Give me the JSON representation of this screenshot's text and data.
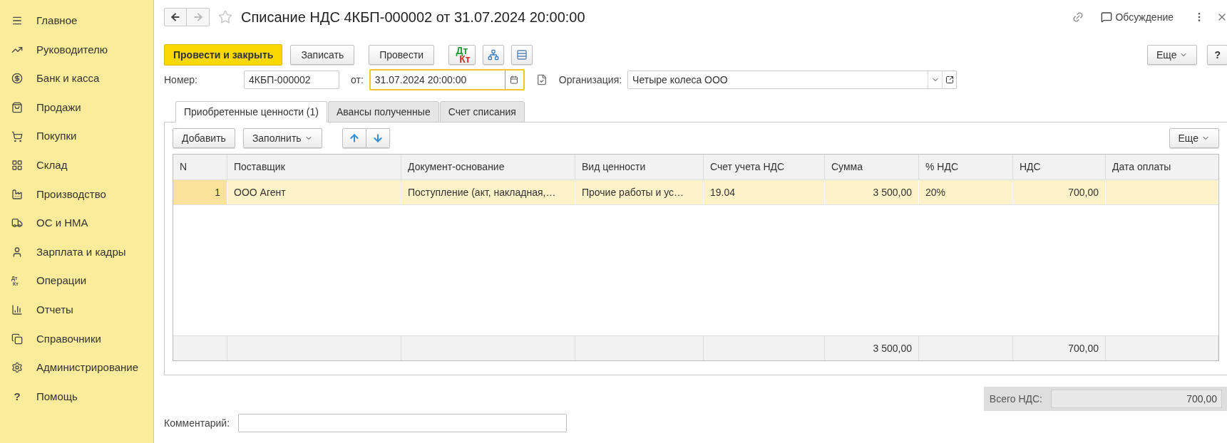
{
  "sidebar": {
    "items": [
      {
        "label": "Главное"
      },
      {
        "label": "Руководителю"
      },
      {
        "label": "Банк и касса"
      },
      {
        "label": "Продажи"
      },
      {
        "label": "Покупки"
      },
      {
        "label": "Склад"
      },
      {
        "label": "Производство"
      },
      {
        "label": "ОС и НМА"
      },
      {
        "label": "Зарплата и кадры"
      },
      {
        "label": "Операции",
        "icon_dt": "Дт",
        "icon_kt": "Кт"
      },
      {
        "label": "Отчеты"
      },
      {
        "label": "Справочники"
      },
      {
        "label": "Администрирование"
      },
      {
        "label": "Помощь",
        "icon_text": "?"
      }
    ]
  },
  "window": {
    "title": "Списание НДС 4КБП-000002 от 31.07.2024 20:00:00",
    "discussion": "Обсуждение"
  },
  "toolbar": {
    "primary": "Провести и закрыть",
    "buttons": [
      "Записать",
      "Провести"
    ],
    "dt_kt": {
      "dt": "Дт",
      "kt": "Кт"
    },
    "more": "Еще",
    "help": "?"
  },
  "header": {
    "number_label": "Номер:",
    "number": "4КБП-000002",
    "date_label": "от:",
    "date": "31.07.2024 20:00:00",
    "date_focused": true,
    "org_label": "Организация:",
    "org": "Четыре колеса ООО"
  },
  "tabs": [
    {
      "label": "Приобретенные ценности (1)",
      "selected": true
    },
    {
      "label": "Авансы полученные",
      "selected": false
    },
    {
      "label": "Счет списания",
      "selected": false
    }
  ],
  "table_toolbar": {
    "add": "Добавить",
    "fill": "Заполнить",
    "more": "Еще"
  },
  "table": {
    "columns": [
      "N",
      "Поставщик",
      "Документ-основание",
      "Вид ценности",
      "Счет учета НДС",
      "Сумма",
      "% НДС",
      "НДС",
      "Дата оплаты"
    ],
    "rows": [
      {
        "selected": true,
        "cells": [
          "1",
          "ООО Агент",
          "Поступление (акт, накладная,…",
          "Прочие работы и ус…",
          "19.04",
          "3 500,00",
          "20%",
          "700,00",
          ""
        ]
      }
    ],
    "footer": {
      "sum_total": "3 500,00",
      "vat_total": "700,00"
    }
  },
  "total_vat": {
    "label": "Всего НДС:",
    "value": "700,00"
  },
  "comment": {
    "label": "Комментарий:"
  }
}
